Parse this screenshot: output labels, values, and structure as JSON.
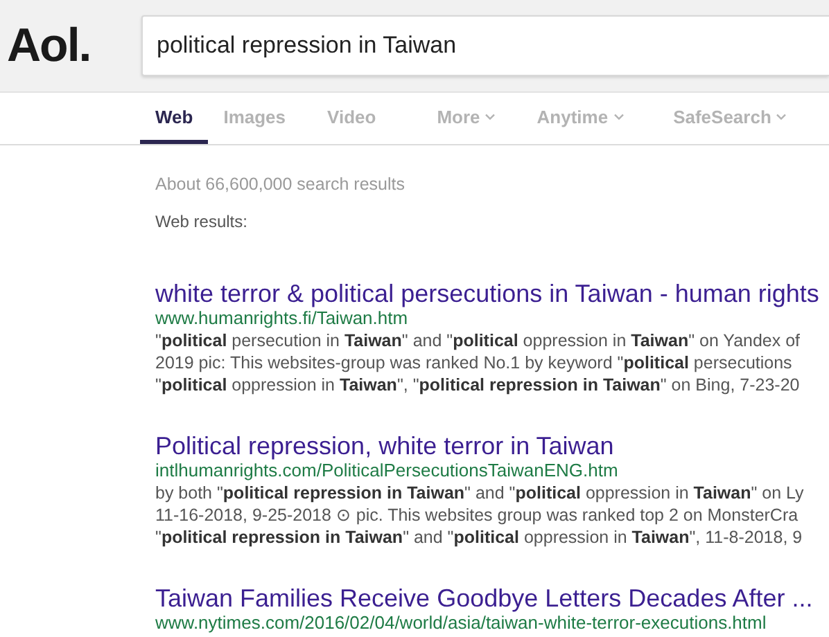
{
  "logo": "Aol.",
  "search": {
    "value": "political repression in Taiwan"
  },
  "tabs": [
    {
      "label": "Web",
      "kind": "tab",
      "selected": true
    },
    {
      "label": "Images",
      "kind": "tab",
      "selected": false
    },
    {
      "label": "Video",
      "kind": "tab",
      "selected": false
    },
    {
      "label": "More",
      "kind": "dropdown",
      "selected": false
    },
    {
      "label": "Anytime",
      "kind": "dropdown",
      "selected": false
    },
    {
      "label": "SafeSearch",
      "kind": "dropdown",
      "selected": false
    }
  ],
  "result_count": "About 66,600,000 search results",
  "section_label": "Web results:",
  "results": [
    {
      "title": "white terror & political persecutions in Taiwan - human rights",
      "url": "www.humanrights.fi/Taiwan.htm",
      "snippet": [
        "\"**political** persecution in **Taiwan**\" and \"**political** oppression in **Taiwan**\" on Yandex of",
        "2019 pic: This websites-group was ranked No.1 by keyword \"**political** persecutions",
        "\"**political** oppression in **Taiwan**\", \"**political repression in Taiwan**\" on Bing, 7-23-20"
      ]
    },
    {
      "title": "Political repression, white terror in Taiwan",
      "url": "intlhumanrights.com/PoliticalPersecutionsTaiwanENG.htm",
      "snippet": [
        "by both \"**political repression in Taiwan**\" and \"**political** oppression in **Taiwan**\" on Ly",
        "11-16-2018, 9-25-2018 ⊙ pic. This websites group was ranked top 2 on MonsterCra",
        "\"**political repression in Taiwan**\" and \"**political** oppression in **Taiwan**\", 11-8-2018, 9"
      ]
    },
    {
      "title": "Taiwan Families Receive Goodbye Letters Decades After ...",
      "url": "www.nytimes.com/2016/02/04/world/asia/taiwan-white-terror-executions.html"
    }
  ]
}
